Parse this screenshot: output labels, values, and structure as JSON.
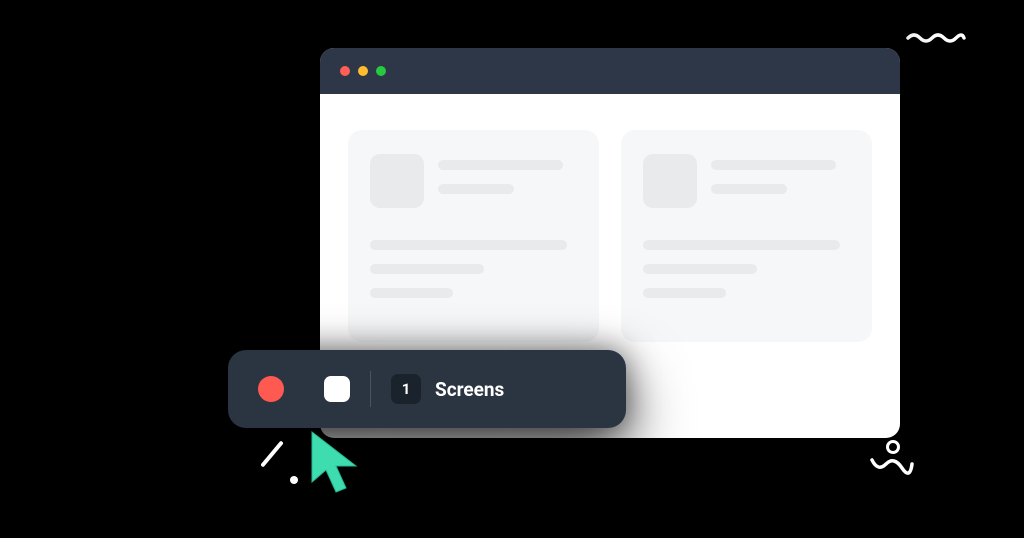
{
  "window": {
    "traffic": {
      "close_icon": "close-dot",
      "minimize_icon": "minimize-dot",
      "maximize_icon": "maximize-dot"
    }
  },
  "toolbar": {
    "record_icon": "record-circle",
    "stop_icon": "stop-square",
    "screen_count": "1",
    "screens_label": "Screens"
  },
  "colors": {
    "window_chrome": "#2d3748",
    "toolbar_bg": "#2b3542",
    "record_red": "#ff5a52",
    "cursor_teal": "#3eddb0"
  }
}
